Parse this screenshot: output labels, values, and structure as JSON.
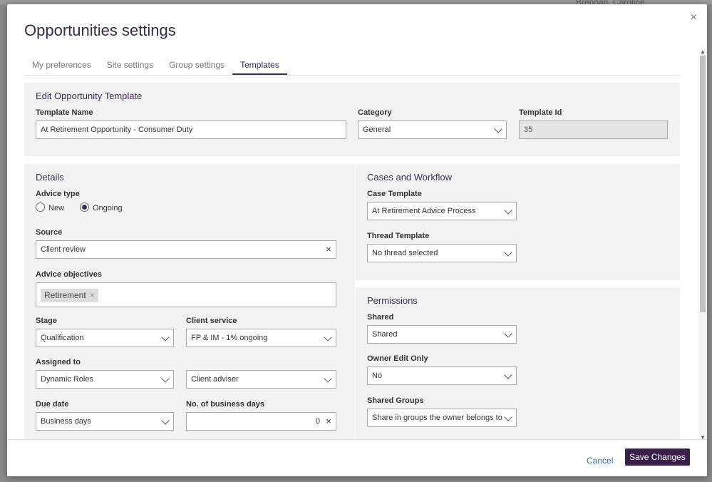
{
  "background": {
    "user_name": "Brennan, Caroline"
  },
  "modal": {
    "title": "Opportunities settings",
    "close_glyph": "×"
  },
  "tabs": [
    {
      "label": "My preferences"
    },
    {
      "label": "Site settings"
    },
    {
      "label": "Group settings"
    },
    {
      "label": "Templates",
      "active": true
    }
  ],
  "edit_template": {
    "heading": "Edit Opportunity Template",
    "template_name_label": "Template Name",
    "template_name_value": "At Retirement Opportunity - Consumer Duty",
    "category_label": "Category",
    "category_value": "General",
    "template_id_label": "Template Id",
    "template_id_value": "35"
  },
  "details": {
    "heading": "Details",
    "advice_type_label": "Advice type",
    "advice_new": "New",
    "advice_ongoing": "Ongoing",
    "advice_selected": "Ongoing",
    "source_label": "Source",
    "source_value": "Client review",
    "objectives_label": "Advice objectives",
    "objective_tag": "Retirement",
    "stage_label": "Stage",
    "stage_value": "Qualification",
    "client_service_label": "Client service",
    "client_service_value": "FP & IM - 1% ongoing",
    "assigned_label": "Assigned to",
    "assigned_value": "Dynamic Roles",
    "assigned_role_value": "Client adviser",
    "due_date_label": "Due date",
    "due_date_value": "Business days",
    "business_days_label": "No. of business days",
    "business_days_value": "0"
  },
  "workflow": {
    "heading": "Cases and Workflow",
    "case_template_label": "Case Template",
    "case_template_value": "At Retirement Advice Process",
    "thread_template_label": "Thread Template",
    "thread_template_value": "No thread selected"
  },
  "permissions": {
    "heading": "Permissions",
    "shared_label": "Shared",
    "shared_value": "Shared",
    "owner_edit_label": "Owner Edit Only",
    "owner_edit_value": "No",
    "shared_groups_label": "Shared Groups",
    "shared_groups_value": "Share in groups the owner belongs to"
  },
  "footer": {
    "cancel_label": "Cancel",
    "save_label": "Save Changes"
  },
  "colors": {
    "accent": "#3d2a55",
    "save_button": "#3a1f4a",
    "link": "#3b6fa9",
    "panel": "#f2f2f2"
  }
}
